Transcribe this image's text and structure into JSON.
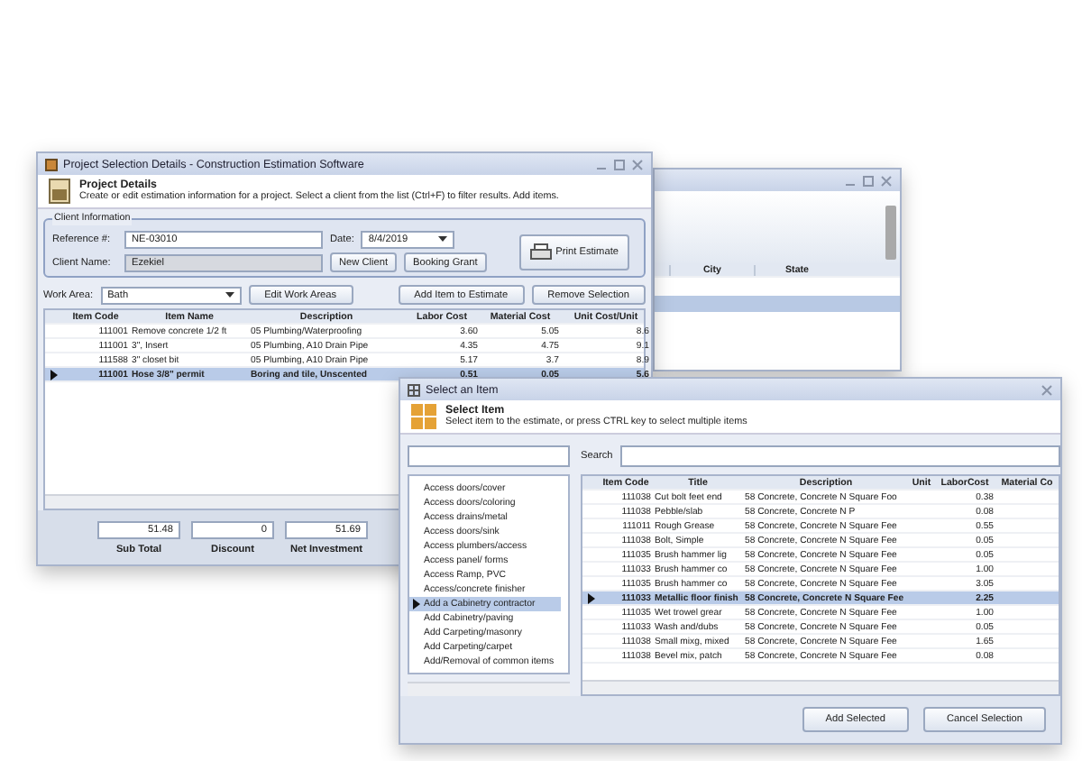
{
  "back_window": {
    "columns": [
      "City",
      "State"
    ]
  },
  "main_window": {
    "title": "Project Selection Details - Construction Estimation Software",
    "header": {
      "title": "Project Details",
      "subtitle": "Create or edit estimation information for a project. Select a client from the list (Ctrl+F) to filter results. Add items."
    },
    "client_group": {
      "title": "Client Information",
      "reference_label": "Reference #:",
      "reference_value": "NE-03010",
      "date_label": "Date:",
      "date_value": "8/4/2019",
      "client_label": "Client Name:",
      "client_value": "Ezekiel",
      "buttons": [
        "New Client",
        "Booking Grant"
      ],
      "print_button": "Print Estimate"
    },
    "work_area": {
      "label": "Work Area:",
      "value": "Bath",
      "edit_button": "Edit Work Areas",
      "buttons": [
        "Add Item to Estimate",
        "Remove Selection"
      ]
    },
    "table": {
      "columns": [
        "Item Code",
        "Item Name",
        "Description",
        "Labor Cost",
        "Material Cost",
        "Unit Cost/Unit"
      ],
      "rows": [
        {
          "cells": [
            "111001",
            "Remove concrete 1/2 ft",
            "05 Plumbing/Waterproofing",
            "3.60",
            "5.05",
            "8.6"
          ],
          "selected": false
        },
        {
          "cells": [
            "111001",
            "3\", Insert",
            "05 Plumbing, A10 Drain Pipe",
            "4.35",
            "4.75",
            "9.1"
          ],
          "selected": false
        },
        {
          "cells": [
            "111588",
            "3\" closet bit",
            "05 Plumbing, A10 Drain Pipe",
            "5.17",
            "3.7",
            "8.9"
          ],
          "selected": false
        },
        {
          "cells": [
            "111001",
            "Hose 3/8\" permit",
            "Boring and tile, Unscented",
            "0.51",
            "0.05",
            "5.6"
          ],
          "selected": true
        }
      ]
    },
    "totals": [
      {
        "label": "Sub Total",
        "value": "51.48"
      },
      {
        "label": "Discount",
        "value": "0"
      },
      {
        "label": "Net Investment",
        "value": "51.69"
      }
    ]
  },
  "dialog": {
    "title": "Select an Item",
    "header": {
      "title": "Select Item",
      "subtitle": "Select item to the estimate, or press CTRL key to select multiple items"
    },
    "search_label": "Search",
    "categories": [
      {
        "label": "Access doors/cover",
        "selected": false
      },
      {
        "label": "Access doors/coloring",
        "selected": false
      },
      {
        "label": "Access drains/metal",
        "selected": false
      },
      {
        "label": "Access doors/sink",
        "selected": false
      },
      {
        "label": "Access plumbers/access",
        "selected": false
      },
      {
        "label": "Access panel/ forms",
        "selected": false
      },
      {
        "label": "Access Ramp, PVC",
        "selected": false
      },
      {
        "label": "Access/concrete finisher",
        "selected": false
      },
      {
        "label": "Add a Cabinetry contractor",
        "selected": true
      },
      {
        "label": "Add Cabinetry/paving",
        "selected": false
      },
      {
        "label": "Add Carpeting/masonry",
        "selected": false
      },
      {
        "label": "Add Carpeting/carpet",
        "selected": false
      },
      {
        "label": "Add/Removal of common items",
        "selected": false
      }
    ],
    "table": {
      "columns": [
        "Item Code",
        "Title",
        "Description",
        "Unit",
        "LaborCost",
        "Material Co"
      ],
      "rows": [
        {
          "cells": [
            "111038",
            "Cut bolt feet end",
            "58 Concrete, Concrete N Square Foo",
            "",
            "0.38",
            ""
          ],
          "selected": false
        },
        {
          "cells": [
            "111038",
            "Pebble/slab",
            "58 Concrete, Concrete N P",
            "",
            "0.08",
            ""
          ],
          "selected": false
        },
        {
          "cells": [
            "111011",
            "Rough Grease",
            "58 Concrete, Concrete N Square Fee",
            "",
            "0.55",
            ""
          ],
          "selected": false
        },
        {
          "cells": [
            "111038",
            "Bolt, Simple",
            "58 Concrete, Concrete N Square Fee",
            "",
            "0.05",
            ""
          ],
          "selected": false
        },
        {
          "cells": [
            "111035",
            "Brush hammer lig",
            "58 Concrete, Concrete N Square Fee",
            "",
            "0.05",
            ""
          ],
          "selected": false
        },
        {
          "cells": [
            "111033",
            "Brush hammer co",
            "58 Concrete, Concrete N Square Fee",
            "",
            "1.00",
            ""
          ],
          "selected": false
        },
        {
          "cells": [
            "111035",
            "Brush hammer co",
            "58 Concrete, Concrete N Square Fee",
            "",
            "3.05",
            ""
          ],
          "selected": false
        },
        {
          "cells": [
            "111033",
            "Metallic floor finish",
            "58 Concrete, Concrete N Square Fee",
            "",
            "2.25",
            ""
          ],
          "selected": true
        },
        {
          "cells": [
            "111035",
            "Wet trowel grear",
            "58 Concrete, Concrete N Square Fee",
            "",
            "1.00",
            ""
          ],
          "selected": false
        },
        {
          "cells": [
            "111033",
            "Wash and/dubs",
            "58 Concrete, Concrete N Square Fee",
            "",
            "0.05",
            ""
          ],
          "selected": false
        },
        {
          "cells": [
            "111038",
            "Small mixg, mixed",
            "58 Concrete, Concrete N Square Fee",
            "",
            "1.65",
            ""
          ],
          "selected": false
        },
        {
          "cells": [
            "111038",
            "Bevel mix, patch",
            "58 Concrete, Concrete N Square Fee",
            "",
            "0.08",
            ""
          ],
          "selected": false
        }
      ]
    },
    "buttons": [
      "Add Selected",
      "Cancel Selection"
    ]
  }
}
